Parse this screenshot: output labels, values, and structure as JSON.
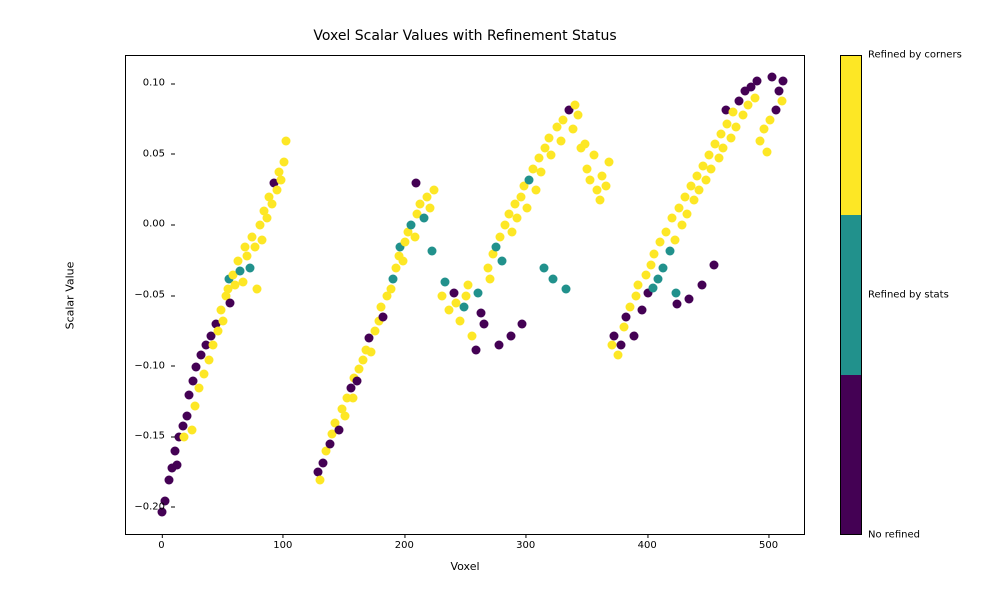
{
  "chart_data": {
    "type": "scatter",
    "title": "Voxel Scalar Values with Refinement Status",
    "xlabel": "Voxel",
    "ylabel": "Scalar Value",
    "xlim": [
      -30,
      530
    ],
    "ylim": [
      -0.22,
      0.12
    ],
    "xticks": [
      0,
      100,
      200,
      300,
      400,
      500
    ],
    "yticks": [
      -0.2,
      -0.15,
      -0.1,
      -0.05,
      0.0,
      0.05,
      0.1
    ],
    "colorbar": {
      "labels": [
        "Refined by corners",
        "Refined by stats",
        "No refined"
      ],
      "colors": {
        "0": "#440154",
        "1": "#21918c",
        "2": "#fde725"
      }
    },
    "points": [
      {
        "x": 0,
        "y": -0.203,
        "c": 0
      },
      {
        "x": 2,
        "y": -0.195,
        "c": 0
      },
      {
        "x": 5,
        "y": -0.18,
        "c": 0
      },
      {
        "x": 8,
        "y": -0.172,
        "c": 0
      },
      {
        "x": 10,
        "y": -0.16,
        "c": 0
      },
      {
        "x": 12,
        "y": -0.17,
        "c": 0
      },
      {
        "x": 14,
        "y": -0.15,
        "c": 0
      },
      {
        "x": 17,
        "y": -0.142,
        "c": 0
      },
      {
        "x": 18,
        "y": -0.15,
        "c": 2
      },
      {
        "x": 20,
        "y": -0.135,
        "c": 0
      },
      {
        "x": 22,
        "y": -0.12,
        "c": 0
      },
      {
        "x": 24,
        "y": -0.145,
        "c": 2
      },
      {
        "x": 25,
        "y": -0.11,
        "c": 0
      },
      {
        "x": 27,
        "y": -0.128,
        "c": 2
      },
      {
        "x": 28,
        "y": -0.1,
        "c": 0
      },
      {
        "x": 30,
        "y": -0.115,
        "c": 2
      },
      {
        "x": 32,
        "y": -0.092,
        "c": 0
      },
      {
        "x": 34,
        "y": -0.105,
        "c": 2
      },
      {
        "x": 36,
        "y": -0.085,
        "c": 0
      },
      {
        "x": 38,
        "y": -0.095,
        "c": 2
      },
      {
        "x": 40,
        "y": -0.078,
        "c": 0
      },
      {
        "x": 42,
        "y": -0.085,
        "c": 2
      },
      {
        "x": 44,
        "y": -0.07,
        "c": 0
      },
      {
        "x": 46,
        "y": -0.075,
        "c": 2
      },
      {
        "x": 48,
        "y": -0.06,
        "c": 2
      },
      {
        "x": 50,
        "y": -0.068,
        "c": 2
      },
      {
        "x": 52,
        "y": -0.05,
        "c": 2
      },
      {
        "x": 54,
        "y": -0.045,
        "c": 2
      },
      {
        "x": 55,
        "y": -0.038,
        "c": 1
      },
      {
        "x": 56,
        "y": -0.055,
        "c": 0
      },
      {
        "x": 58,
        "y": -0.035,
        "c": 2
      },
      {
        "x": 60,
        "y": -0.042,
        "c": 2
      },
      {
        "x": 62,
        "y": -0.025,
        "c": 2
      },
      {
        "x": 64,
        "y": -0.032,
        "c": 1
      },
      {
        "x": 66,
        "y": -0.04,
        "c": 2
      },
      {
        "x": 68,
        "y": -0.015,
        "c": 2
      },
      {
        "x": 70,
        "y": -0.022,
        "c": 2
      },
      {
        "x": 72,
        "y": -0.03,
        "c": 1
      },
      {
        "x": 74,
        "y": -0.008,
        "c": 2
      },
      {
        "x": 76,
        "y": -0.015,
        "c": 2
      },
      {
        "x": 78,
        "y": -0.045,
        "c": 2
      },
      {
        "x": 80,
        "y": 0.0,
        "c": 2
      },
      {
        "x": 82,
        "y": -0.01,
        "c": 2
      },
      {
        "x": 84,
        "y": 0.01,
        "c": 2
      },
      {
        "x": 86,
        "y": 0.005,
        "c": 2
      },
      {
        "x": 88,
        "y": 0.02,
        "c": 2
      },
      {
        "x": 90,
        "y": 0.015,
        "c": 2
      },
      {
        "x": 92,
        "y": 0.03,
        "c": 0
      },
      {
        "x": 94,
        "y": 0.025,
        "c": 2
      },
      {
        "x": 96,
        "y": 0.038,
        "c": 2
      },
      {
        "x": 98,
        "y": 0.032,
        "c": 2
      },
      {
        "x": 100,
        "y": 0.045,
        "c": 2
      },
      {
        "x": 102,
        "y": 0.06,
        "c": 2
      },
      {
        "x": 128,
        "y": -0.175,
        "c": 0
      },
      {
        "x": 130,
        "y": -0.18,
        "c": 2
      },
      {
        "x": 132,
        "y": -0.168,
        "c": 0
      },
      {
        "x": 135,
        "y": -0.16,
        "c": 2
      },
      {
        "x": 138,
        "y": -0.155,
        "c": 0
      },
      {
        "x": 140,
        "y": -0.148,
        "c": 2
      },
      {
        "x": 142,
        "y": -0.14,
        "c": 2
      },
      {
        "x": 145,
        "y": -0.145,
        "c": 0
      },
      {
        "x": 148,
        "y": -0.13,
        "c": 2
      },
      {
        "x": 150,
        "y": -0.135,
        "c": 2
      },
      {
        "x": 152,
        "y": -0.122,
        "c": 2
      },
      {
        "x": 155,
        "y": -0.115,
        "c": 0
      },
      {
        "x": 157,
        "y": -0.122,
        "c": 2
      },
      {
        "x": 158,
        "y": -0.108,
        "c": 2
      },
      {
        "x": 160,
        "y": -0.11,
        "c": 0
      },
      {
        "x": 162,
        "y": -0.102,
        "c": 2
      },
      {
        "x": 165,
        "y": -0.095,
        "c": 2
      },
      {
        "x": 168,
        "y": -0.088,
        "c": 2
      },
      {
        "x": 170,
        "y": -0.08,
        "c": 0
      },
      {
        "x": 172,
        "y": -0.09,
        "c": 2
      },
      {
        "x": 175,
        "y": -0.075,
        "c": 2
      },
      {
        "x": 178,
        "y": -0.068,
        "c": 2
      },
      {
        "x": 180,
        "y": -0.058,
        "c": 2
      },
      {
        "x": 182,
        "y": -0.065,
        "c": 0
      },
      {
        "x": 185,
        "y": -0.05,
        "c": 2
      },
      {
        "x": 188,
        "y": -0.045,
        "c": 2
      },
      {
        "x": 190,
        "y": -0.038,
        "c": 1
      },
      {
        "x": 192,
        "y": -0.03,
        "c": 2
      },
      {
        "x": 195,
        "y": -0.022,
        "c": 2
      },
      {
        "x": 196,
        "y": -0.015,
        "c": 1
      },
      {
        "x": 198,
        "y": -0.025,
        "c": 2
      },
      {
        "x": 200,
        "y": -0.012,
        "c": 2
      },
      {
        "x": 202,
        "y": -0.005,
        "c": 2
      },
      {
        "x": 205,
        "y": 0.0,
        "c": 1
      },
      {
        "x": 208,
        "y": -0.008,
        "c": 2
      },
      {
        "x": 209,
        "y": 0.03,
        "c": 0
      },
      {
        "x": 210,
        "y": 0.008,
        "c": 2
      },
      {
        "x": 212,
        "y": 0.015,
        "c": 2
      },
      {
        "x": 215,
        "y": 0.005,
        "c": 1
      },
      {
        "x": 218,
        "y": 0.02,
        "c": 2
      },
      {
        "x": 220,
        "y": 0.012,
        "c": 2
      },
      {
        "x": 222,
        "y": -0.018,
        "c": 1
      },
      {
        "x": 224,
        "y": 0.025,
        "c": 2
      },
      {
        "x": 230,
        "y": -0.05,
        "c": 2
      },
      {
        "x": 233,
        "y": -0.04,
        "c": 1
      },
      {
        "x": 236,
        "y": -0.06,
        "c": 2
      },
      {
        "x": 240,
        "y": -0.048,
        "c": 0
      },
      {
        "x": 242,
        "y": -0.055,
        "c": 2
      },
      {
        "x": 245,
        "y": -0.068,
        "c": 2
      },
      {
        "x": 248,
        "y": -0.058,
        "c": 1
      },
      {
        "x": 250,
        "y": -0.05,
        "c": 2
      },
      {
        "x": 252,
        "y": -0.042,
        "c": 2
      },
      {
        "x": 255,
        "y": -0.078,
        "c": 2
      },
      {
        "x": 258,
        "y": -0.088,
        "c": 0
      },
      {
        "x": 260,
        "y": -0.048,
        "c": 1
      },
      {
        "x": 262,
        "y": -0.062,
        "c": 0
      },
      {
        "x": 265,
        "y": -0.07,
        "c": 0
      },
      {
        "x": 268,
        "y": -0.03,
        "c": 2
      },
      {
        "x": 270,
        "y": -0.038,
        "c": 2
      },
      {
        "x": 272,
        "y": -0.02,
        "c": 2
      },
      {
        "x": 275,
        "y": -0.015,
        "c": 1
      },
      {
        "x": 277,
        "y": -0.085,
        "c": 0
      },
      {
        "x": 278,
        "y": -0.008,
        "c": 2
      },
      {
        "x": 280,
        "y": -0.025,
        "c": 1
      },
      {
        "x": 282,
        "y": 0.0,
        "c": 2
      },
      {
        "x": 285,
        "y": 0.008,
        "c": 2
      },
      {
        "x": 287,
        "y": -0.078,
        "c": 0
      },
      {
        "x": 288,
        "y": -0.005,
        "c": 2
      },
      {
        "x": 290,
        "y": 0.015,
        "c": 2
      },
      {
        "x": 292,
        "y": 0.005,
        "c": 2
      },
      {
        "x": 295,
        "y": 0.02,
        "c": 2
      },
      {
        "x": 296,
        "y": -0.07,
        "c": 0
      },
      {
        "x": 298,
        "y": 0.028,
        "c": 2
      },
      {
        "x": 300,
        "y": 0.012,
        "c": 2
      },
      {
        "x": 302,
        "y": 0.032,
        "c": 1
      },
      {
        "x": 305,
        "y": 0.04,
        "c": 2
      },
      {
        "x": 308,
        "y": 0.025,
        "c": 2
      },
      {
        "x": 310,
        "y": 0.048,
        "c": 2
      },
      {
        "x": 312,
        "y": 0.038,
        "c": 2
      },
      {
        "x": 314,
        "y": -0.03,
        "c": 1
      },
      {
        "x": 315,
        "y": 0.055,
        "c": 2
      },
      {
        "x": 318,
        "y": 0.062,
        "c": 2
      },
      {
        "x": 320,
        "y": 0.05,
        "c": 2
      },
      {
        "x": 322,
        "y": -0.038,
        "c": 1
      },
      {
        "x": 325,
        "y": 0.07,
        "c": 2
      },
      {
        "x": 328,
        "y": 0.06,
        "c": 2
      },
      {
        "x": 330,
        "y": 0.075,
        "c": 2
      },
      {
        "x": 332,
        "y": -0.045,
        "c": 1
      },
      {
        "x": 335,
        "y": 0.082,
        "c": 0
      },
      {
        "x": 338,
        "y": 0.068,
        "c": 2
      },
      {
        "x": 340,
        "y": 0.085,
        "c": 2
      },
      {
        "x": 342,
        "y": 0.078,
        "c": 2
      },
      {
        "x": 345,
        "y": 0.055,
        "c": 2
      },
      {
        "x": 348,
        "y": 0.058,
        "c": 2
      },
      {
        "x": 350,
        "y": 0.04,
        "c": 2
      },
      {
        "x": 352,
        "y": 0.032,
        "c": 2
      },
      {
        "x": 355,
        "y": 0.05,
        "c": 2
      },
      {
        "x": 358,
        "y": 0.025,
        "c": 2
      },
      {
        "x": 360,
        "y": 0.018,
        "c": 2
      },
      {
        "x": 362,
        "y": 0.035,
        "c": 2
      },
      {
        "x": 365,
        "y": 0.028,
        "c": 2
      },
      {
        "x": 368,
        "y": 0.045,
        "c": 2
      },
      {
        "x": 370,
        "y": -0.085,
        "c": 2
      },
      {
        "x": 372,
        "y": -0.078,
        "c": 0
      },
      {
        "x": 375,
        "y": -0.092,
        "c": 2
      },
      {
        "x": 378,
        "y": -0.085,
        "c": 0
      },
      {
        "x": 380,
        "y": -0.072,
        "c": 2
      },
      {
        "x": 382,
        "y": -0.065,
        "c": 0
      },
      {
        "x": 385,
        "y": -0.058,
        "c": 2
      },
      {
        "x": 388,
        "y": -0.078,
        "c": 0
      },
      {
        "x": 390,
        "y": -0.05,
        "c": 2
      },
      {
        "x": 392,
        "y": -0.042,
        "c": 2
      },
      {
        "x": 395,
        "y": -0.06,
        "c": 0
      },
      {
        "x": 398,
        "y": -0.035,
        "c": 2
      },
      {
        "x": 400,
        "y": -0.048,
        "c": 0
      },
      {
        "x": 402,
        "y": -0.028,
        "c": 2
      },
      {
        "x": 404,
        "y": -0.044,
        "c": 1
      },
      {
        "x": 405,
        "y": -0.02,
        "c": 2
      },
      {
        "x": 408,
        "y": -0.038,
        "c": 1
      },
      {
        "x": 410,
        "y": -0.012,
        "c": 2
      },
      {
        "x": 412,
        "y": -0.03,
        "c": 1
      },
      {
        "x": 415,
        "y": -0.005,
        "c": 2
      },
      {
        "x": 418,
        "y": -0.018,
        "c": 1
      },
      {
        "x": 420,
        "y": 0.005,
        "c": 2
      },
      {
        "x": 422,
        "y": -0.01,
        "c": 2
      },
      {
        "x": 423,
        "y": -0.048,
        "c": 1
      },
      {
        "x": 424,
        "y": -0.056,
        "c": 0
      },
      {
        "x": 425,
        "y": 0.012,
        "c": 2
      },
      {
        "x": 428,
        "y": 0.0,
        "c": 2
      },
      {
        "x": 430,
        "y": 0.02,
        "c": 2
      },
      {
        "x": 432,
        "y": 0.008,
        "c": 2
      },
      {
        "x": 434,
        "y": -0.052,
        "c": 0
      },
      {
        "x": 435,
        "y": 0.028,
        "c": 2
      },
      {
        "x": 438,
        "y": 0.018,
        "c": 2
      },
      {
        "x": 440,
        "y": 0.035,
        "c": 2
      },
      {
        "x": 442,
        "y": 0.025,
        "c": 2
      },
      {
        "x": 444,
        "y": -0.042,
        "c": 0
      },
      {
        "x": 445,
        "y": 0.042,
        "c": 2
      },
      {
        "x": 448,
        "y": 0.032,
        "c": 2
      },
      {
        "x": 450,
        "y": 0.05,
        "c": 2
      },
      {
        "x": 452,
        "y": 0.04,
        "c": 2
      },
      {
        "x": 454,
        "y": -0.028,
        "c": 0
      },
      {
        "x": 455,
        "y": 0.058,
        "c": 2
      },
      {
        "x": 458,
        "y": 0.048,
        "c": 2
      },
      {
        "x": 460,
        "y": 0.065,
        "c": 2
      },
      {
        "x": 462,
        "y": 0.055,
        "c": 2
      },
      {
        "x": 464,
        "y": 0.082,
        "c": 0
      },
      {
        "x": 465,
        "y": 0.072,
        "c": 2
      },
      {
        "x": 468,
        "y": 0.062,
        "c": 2
      },
      {
        "x": 470,
        "y": 0.08,
        "c": 2
      },
      {
        "x": 472,
        "y": 0.07,
        "c": 2
      },
      {
        "x": 475,
        "y": 0.088,
        "c": 0
      },
      {
        "x": 478,
        "y": 0.078,
        "c": 2
      },
      {
        "x": 480,
        "y": 0.095,
        "c": 0
      },
      {
        "x": 482,
        "y": 0.085,
        "c": 2
      },
      {
        "x": 485,
        "y": 0.098,
        "c": 0
      },
      {
        "x": 488,
        "y": 0.09,
        "c": 2
      },
      {
        "x": 490,
        "y": 0.102,
        "c": 0
      },
      {
        "x": 492,
        "y": 0.06,
        "c": 2
      },
      {
        "x": 495,
        "y": 0.068,
        "c": 2
      },
      {
        "x": 498,
        "y": 0.052,
        "c": 2
      },
      {
        "x": 500,
        "y": 0.075,
        "c": 2
      },
      {
        "x": 502,
        "y": 0.105,
        "c": 0
      },
      {
        "x": 505,
        "y": 0.082,
        "c": 0
      },
      {
        "x": 508,
        "y": 0.095,
        "c": 0
      },
      {
        "x": 510,
        "y": 0.088,
        "c": 2
      },
      {
        "x": 511,
        "y": 0.102,
        "c": 0
      }
    ]
  }
}
